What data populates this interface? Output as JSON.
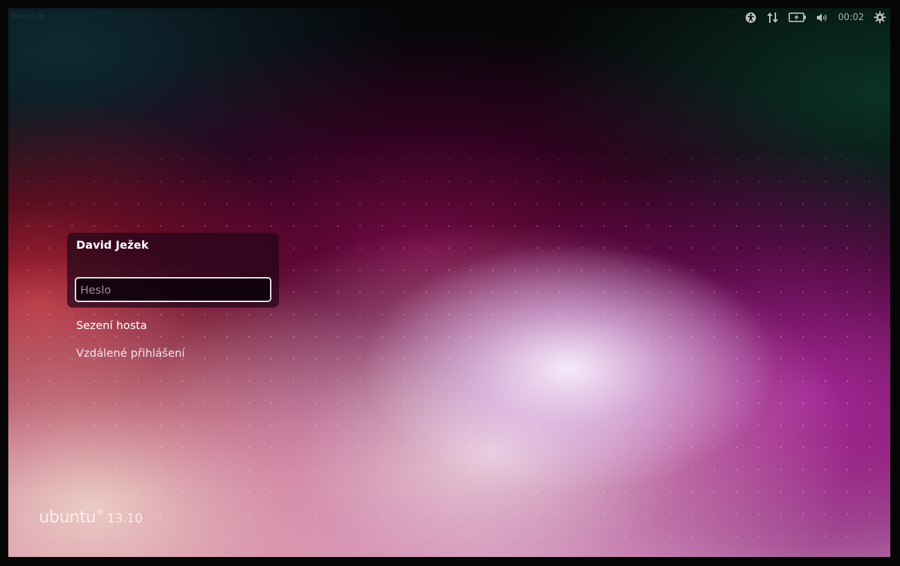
{
  "screen": {
    "hostname": "david-ip",
    "version": "13.10",
    "brand": "ubuntu",
    "registered_mark": "®"
  },
  "indicators": [
    {
      "icon": "accessibility-icon"
    },
    {
      "icon": "network-icon"
    },
    {
      "icon": "battery-icon"
    },
    {
      "icon": "volume-icon"
    }
  ],
  "clock": "00:02",
  "login": {
    "user_name": "David Ježek",
    "password_placeholder": "Heslo"
  },
  "sessions": {
    "guest": "Sezení hosta",
    "remote": "Vzdálené přihlášení"
  },
  "colors": {
    "panel_text": "#bfbfbf",
    "login_box_bg": "#23051a",
    "field_border": "#e8e8e8"
  }
}
